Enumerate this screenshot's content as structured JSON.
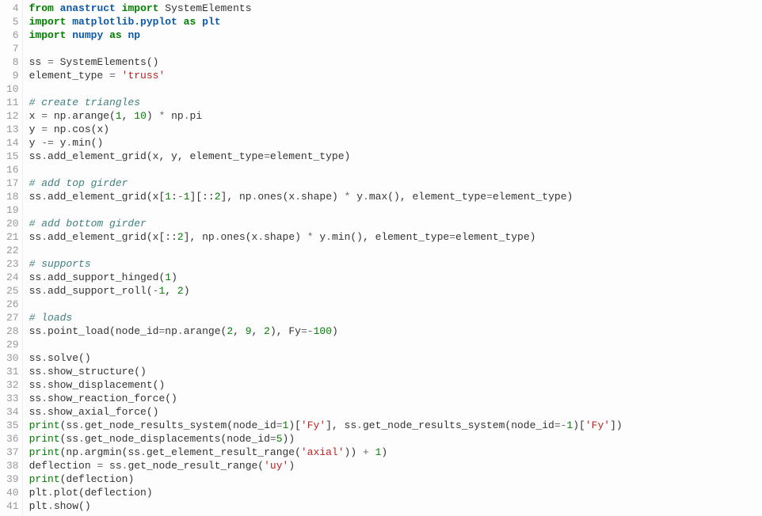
{
  "gutter_start": 4,
  "lines": [
    [
      [
        "kw",
        "from"
      ],
      [
        "n",
        " "
      ],
      [
        "nn",
        "anastruct"
      ],
      [
        "n",
        " "
      ],
      [
        "kw",
        "import"
      ],
      [
        "n",
        " SystemElements"
      ]
    ],
    [
      [
        "kw",
        "import"
      ],
      [
        "n",
        " "
      ],
      [
        "nn",
        "matplotlib.pyplot"
      ],
      [
        "n",
        " "
      ],
      [
        "kw",
        "as"
      ],
      [
        "n",
        " "
      ],
      [
        "nn",
        "plt"
      ]
    ],
    [
      [
        "kw",
        "import"
      ],
      [
        "n",
        " "
      ],
      [
        "nn",
        "numpy"
      ],
      [
        "n",
        " "
      ],
      [
        "kw",
        "as"
      ],
      [
        "n",
        " "
      ],
      [
        "nn",
        "np"
      ]
    ],
    [],
    [
      [
        "n",
        "ss "
      ],
      [
        "op",
        "="
      ],
      [
        "n",
        " SystemElements()"
      ]
    ],
    [
      [
        "n",
        "element_type "
      ],
      [
        "op",
        "="
      ],
      [
        "n",
        " "
      ],
      [
        "s",
        "'truss'"
      ]
    ],
    [],
    [
      [
        "c",
        "# create triangles"
      ]
    ],
    [
      [
        "n",
        "x "
      ],
      [
        "op",
        "="
      ],
      [
        "n",
        " np"
      ],
      [
        "op",
        "."
      ],
      [
        "n",
        "arange("
      ],
      [
        "mi",
        "1"
      ],
      [
        "n",
        ", "
      ],
      [
        "mi",
        "10"
      ],
      [
        "n",
        ") "
      ],
      [
        "op",
        "*"
      ],
      [
        "n",
        " np"
      ],
      [
        "op",
        "."
      ],
      [
        "n",
        "pi"
      ]
    ],
    [
      [
        "n",
        "y "
      ],
      [
        "op",
        "="
      ],
      [
        "n",
        " np"
      ],
      [
        "op",
        "."
      ],
      [
        "n",
        "cos(x)"
      ]
    ],
    [
      [
        "n",
        "y "
      ],
      [
        "op",
        "-="
      ],
      [
        "n",
        " y"
      ],
      [
        "op",
        "."
      ],
      [
        "n",
        "min()"
      ]
    ],
    [
      [
        "n",
        "ss"
      ],
      [
        "op",
        "."
      ],
      [
        "n",
        "add_element_grid(x, y, element_type"
      ],
      [
        "op",
        "="
      ],
      [
        "n",
        "element_type)"
      ]
    ],
    [],
    [
      [
        "c",
        "# add top girder"
      ]
    ],
    [
      [
        "n",
        "ss"
      ],
      [
        "op",
        "."
      ],
      [
        "n",
        "add_element_grid(x["
      ],
      [
        "mi",
        "1"
      ],
      [
        "n",
        ":"
      ],
      [
        "op",
        "-"
      ],
      [
        "mi",
        "1"
      ],
      [
        "n",
        "][::"
      ],
      [
        "mi",
        "2"
      ],
      [
        "n",
        "], np"
      ],
      [
        "op",
        "."
      ],
      [
        "n",
        "ones(x"
      ],
      [
        "op",
        "."
      ],
      [
        "n",
        "shape) "
      ],
      [
        "op",
        "*"
      ],
      [
        "n",
        " y"
      ],
      [
        "op",
        "."
      ],
      [
        "n",
        "max(), element_type"
      ],
      [
        "op",
        "="
      ],
      [
        "n",
        "element_type)"
      ]
    ],
    [],
    [
      [
        "c",
        "# add bottom girder"
      ]
    ],
    [
      [
        "n",
        "ss"
      ],
      [
        "op",
        "."
      ],
      [
        "n",
        "add_element_grid(x[::"
      ],
      [
        "mi",
        "2"
      ],
      [
        "n",
        "], np"
      ],
      [
        "op",
        "."
      ],
      [
        "n",
        "ones(x"
      ],
      [
        "op",
        "."
      ],
      [
        "n",
        "shape) "
      ],
      [
        "op",
        "*"
      ],
      [
        "n",
        " y"
      ],
      [
        "op",
        "."
      ],
      [
        "n",
        "min(), element_type"
      ],
      [
        "op",
        "="
      ],
      [
        "n",
        "element_type)"
      ]
    ],
    [],
    [
      [
        "c",
        "# supports"
      ]
    ],
    [
      [
        "n",
        "ss"
      ],
      [
        "op",
        "."
      ],
      [
        "n",
        "add_support_hinged("
      ],
      [
        "mi",
        "1"
      ],
      [
        "n",
        ")"
      ]
    ],
    [
      [
        "n",
        "ss"
      ],
      [
        "op",
        "."
      ],
      [
        "n",
        "add_support_roll("
      ],
      [
        "op",
        "-"
      ],
      [
        "mi",
        "1"
      ],
      [
        "n",
        ", "
      ],
      [
        "mi",
        "2"
      ],
      [
        "n",
        ")"
      ]
    ],
    [],
    [
      [
        "c",
        "# loads"
      ]
    ],
    [
      [
        "n",
        "ss"
      ],
      [
        "op",
        "."
      ],
      [
        "n",
        "point_load(node_id"
      ],
      [
        "op",
        "="
      ],
      [
        "n",
        "np"
      ],
      [
        "op",
        "."
      ],
      [
        "n",
        "arange("
      ],
      [
        "mi",
        "2"
      ],
      [
        "n",
        ", "
      ],
      [
        "mi",
        "9"
      ],
      [
        "n",
        ", "
      ],
      [
        "mi",
        "2"
      ],
      [
        "n",
        "), Fy"
      ],
      [
        "op",
        "=-"
      ],
      [
        "mi",
        "100"
      ],
      [
        "n",
        ")"
      ]
    ],
    [],
    [
      [
        "n",
        "ss"
      ],
      [
        "op",
        "."
      ],
      [
        "n",
        "solve()"
      ]
    ],
    [
      [
        "n",
        "ss"
      ],
      [
        "op",
        "."
      ],
      [
        "n",
        "show_structure()"
      ]
    ],
    [
      [
        "n",
        "ss"
      ],
      [
        "op",
        "."
      ],
      [
        "n",
        "show_displacement()"
      ]
    ],
    [
      [
        "n",
        "ss"
      ],
      [
        "op",
        "."
      ],
      [
        "n",
        "show_reaction_force()"
      ]
    ],
    [
      [
        "n",
        "ss"
      ],
      [
        "op",
        "."
      ],
      [
        "n",
        "show_axial_force()"
      ]
    ],
    [
      [
        "bp",
        "print"
      ],
      [
        "n",
        "(ss"
      ],
      [
        "op",
        "."
      ],
      [
        "n",
        "get_node_results_system(node_id"
      ],
      [
        "op",
        "="
      ],
      [
        "mi",
        "1"
      ],
      [
        "n",
        ")["
      ],
      [
        "s",
        "'Fy'"
      ],
      [
        "n",
        "], ss"
      ],
      [
        "op",
        "."
      ],
      [
        "n",
        "get_node_results_system(node_id"
      ],
      [
        "op",
        "=-"
      ],
      [
        "mi",
        "1"
      ],
      [
        "n",
        ")["
      ],
      [
        "s",
        "'Fy'"
      ],
      [
        "n",
        "])"
      ]
    ],
    [
      [
        "bp",
        "print"
      ],
      [
        "n",
        "(ss"
      ],
      [
        "op",
        "."
      ],
      [
        "n",
        "get_node_displacements(node_id"
      ],
      [
        "op",
        "="
      ],
      [
        "mi",
        "5"
      ],
      [
        "n",
        "))"
      ]
    ],
    [
      [
        "bp",
        "print"
      ],
      [
        "n",
        "(np"
      ],
      [
        "op",
        "."
      ],
      [
        "n",
        "argmin(ss"
      ],
      [
        "op",
        "."
      ],
      [
        "n",
        "get_element_result_range("
      ],
      [
        "s",
        "'axial'"
      ],
      [
        "n",
        ")) "
      ],
      [
        "op",
        "+"
      ],
      [
        "n",
        " "
      ],
      [
        "mi",
        "1"
      ],
      [
        "n",
        ")"
      ]
    ],
    [
      [
        "n",
        "deflection "
      ],
      [
        "op",
        "="
      ],
      [
        "n",
        " ss"
      ],
      [
        "op",
        "."
      ],
      [
        "n",
        "get_node_result_range("
      ],
      [
        "s",
        "'uy'"
      ],
      [
        "n",
        ")"
      ]
    ],
    [
      [
        "bp",
        "print"
      ],
      [
        "n",
        "(deflection)"
      ]
    ],
    [
      [
        "n",
        "plt"
      ],
      [
        "op",
        "."
      ],
      [
        "n",
        "plot(deflection)"
      ]
    ],
    [
      [
        "n",
        "plt"
      ],
      [
        "op",
        "."
      ],
      [
        "n",
        "show()"
      ]
    ]
  ]
}
